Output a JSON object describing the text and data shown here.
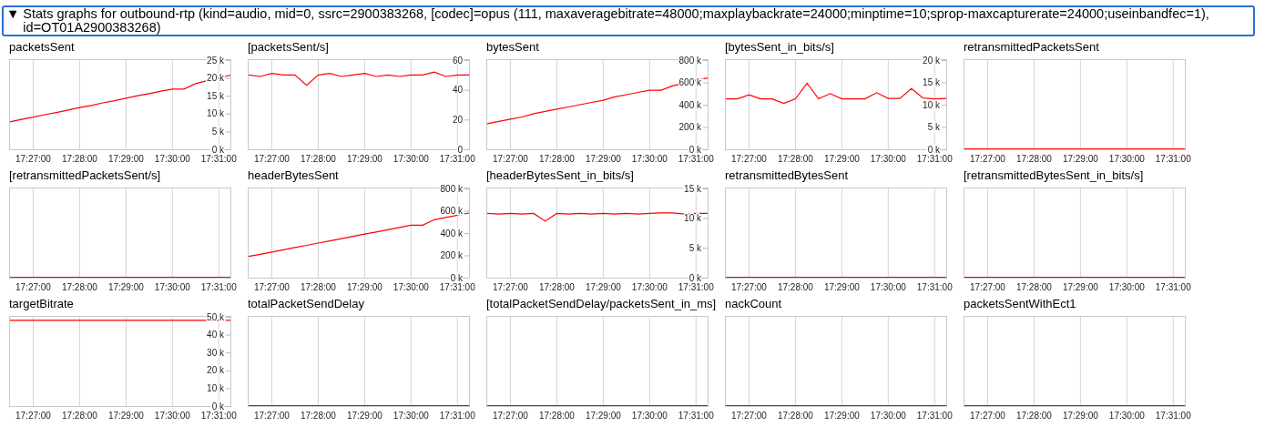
{
  "section": {
    "toggle": "▼",
    "title": "Stats graphs for outbound-rtp (kind=audio, mid=0, ssrc=2900383268, [codec]=opus (111, maxaveragebitrate=48000;maxplaybackrate=24000;minptime=10;sprop-maxcapturerate=24000;useinbandfec=1), id=OT01A2900383268)"
  },
  "charts": [
    {
      "kind": "plot",
      "chart_data": {
        "type": "line",
        "title": "packetsSent",
        "grid": true,
        "categories": [
          null,
          null,
          "17:27:00",
          null,
          null,
          null,
          "17:28:00",
          null,
          null,
          null,
          "17:29:00",
          null,
          null,
          null,
          "17:30:00",
          null,
          null,
          null,
          "17:31:00",
          null
        ],
        "values": [
          7700,
          8400,
          9000,
          9700,
          10300,
          11000,
          11700,
          12300,
          13000,
          13600,
          14300,
          15000,
          15600,
          16300,
          16900,
          16900,
          18400,
          19200,
          20000,
          20800
        ],
        "ylim": [
          0,
          25000
        ],
        "yticks": [
          {
            "value": 0,
            "label": "0 k"
          },
          {
            "value": 5000,
            "label": "5 k"
          },
          {
            "value": 10000,
            "label": "10 k"
          },
          {
            "value": 15000,
            "label": "15 k"
          },
          {
            "value": 20000,
            "label": "20 k"
          },
          {
            "value": 25000,
            "label": "25 k"
          }
        ]
      }
    },
    {
      "kind": "plot",
      "chart_data": {
        "type": "line",
        "title": "[packetsSent/s]",
        "grid": true,
        "categories": [
          null,
          null,
          "17:27:00",
          null,
          null,
          null,
          "17:28:00",
          null,
          null,
          null,
          "17:29:00",
          null,
          null,
          null,
          "17:30:00",
          null,
          null,
          null,
          "17:31:00",
          null
        ],
        "values": [
          50,
          49,
          51,
          50,
          50,
          43,
          50,
          51,
          49,
          50,
          51,
          49,
          50,
          49,
          50,
          50,
          52,
          49,
          50,
          50
        ],
        "ylim": [
          0,
          60
        ],
        "yticks": [
          0,
          20,
          40,
          60
        ]
      }
    },
    {
      "kind": "plot",
      "chart_data": {
        "type": "line",
        "title": "bytesSent",
        "grid": true,
        "categories": [
          null,
          null,
          "17:27:00",
          null,
          null,
          null,
          "17:28:00",
          null,
          null,
          null,
          "17:29:00",
          null,
          null,
          null,
          "17:30:00",
          null,
          null,
          null,
          "17:31:00",
          null
        ],
        "values": [
          230000,
          250000,
          270000,
          290000,
          320000,
          340000,
          360000,
          380000,
          400000,
          420000,
          440000,
          470000,
          490000,
          510000,
          530000,
          530000,
          570000,
          590000,
          620000,
          640000
        ],
        "ylim": [
          0,
          800000
        ],
        "yticks": [
          {
            "value": 0,
            "label": "0 k"
          },
          {
            "value": 200000,
            "label": "200 k"
          },
          {
            "value": 400000,
            "label": "400 k"
          },
          {
            "value": 600000,
            "label": "600 k"
          },
          {
            "value": 800000,
            "label": "800 k"
          }
        ]
      }
    },
    {
      "kind": "plot",
      "chart_data": {
        "type": "line",
        "title": "[bytesSent_in_bits/s]",
        "grid": true,
        "categories": [
          null,
          null,
          "17:27:00",
          null,
          null,
          null,
          "17:28:00",
          null,
          null,
          null,
          "17:29:00",
          null,
          null,
          null,
          "17:30:00",
          null,
          null,
          null,
          "17:31:00",
          null
        ],
        "values": [
          11300,
          11300,
          12200,
          11300,
          11300,
          10300,
          11300,
          14800,
          11300,
          12500,
          11300,
          11300,
          11300,
          12700,
          11400,
          11400,
          13600,
          11500,
          11300,
          11400
        ],
        "ylim": [
          0,
          20000
        ],
        "yticks": [
          {
            "value": 0,
            "label": "0 k"
          },
          {
            "value": 5000,
            "label": "5 k"
          },
          {
            "value": 10000,
            "label": "10 k"
          },
          {
            "value": 15000,
            "label": "15 k"
          },
          {
            "value": 20000,
            "label": "20 k"
          }
        ]
      }
    },
    {
      "kind": "flat",
      "title": "retransmittedPacketsSent",
      "grid": true,
      "x_labels": [
        "17:27:00",
        "17:28:00",
        "17:29:00",
        "17:30:00",
        "17:31:00"
      ]
    },
    {
      "kind": "flat",
      "title": "[retransmittedPacketsSent/s]",
      "grid": true,
      "x_labels": [
        "17:27:00",
        "17:28:00",
        "17:29:00",
        "17:30:00",
        "17:31:00"
      ]
    },
    {
      "kind": "plot",
      "chart_data": {
        "type": "line",
        "title": "headerBytesSent",
        "grid": true,
        "categories": [
          null,
          null,
          "17:27:00",
          null,
          null,
          null,
          "17:28:00",
          null,
          null,
          null,
          "17:29:00",
          null,
          null,
          null,
          "17:30:00",
          null,
          null,
          null,
          "17:31:00",
          null
        ],
        "values": [
          190000,
          210000,
          230000,
          250000,
          270000,
          290000,
          310000,
          330000,
          350000,
          370000,
          390000,
          410000,
          430000,
          450000,
          470000,
          470000,
          520000,
          540000,
          560000,
          580000
        ],
        "ylim": [
          0,
          800000
        ],
        "yticks": [
          {
            "value": 0,
            "label": "0 k"
          },
          {
            "value": 200000,
            "label": "200 k"
          },
          {
            "value": 400000,
            "label": "400 k"
          },
          {
            "value": 600000,
            "label": "600 k"
          },
          {
            "value": 800000,
            "label": "800 k"
          }
        ]
      }
    },
    {
      "kind": "plot",
      "chart_data": {
        "type": "line",
        "title": "[headerBytesSent_in_bits/s]",
        "grid": true,
        "categories": [
          null,
          null,
          "17:27:00",
          null,
          null,
          null,
          "17:28:00",
          null,
          null,
          null,
          "17:29:00",
          null,
          null,
          null,
          "17:30:00",
          null,
          null,
          null,
          "17:31:00",
          null
        ],
        "values": [
          10800,
          10700,
          10800,
          10700,
          10800,
          9500,
          10800,
          10700,
          10800,
          10700,
          10800,
          10700,
          10800,
          10700,
          10800,
          10900,
          10900,
          10700,
          10800,
          10800
        ],
        "ylim": [
          0,
          15000
        ],
        "yticks": [
          {
            "value": 0,
            "label": "0 k"
          },
          {
            "value": 5000,
            "label": "5 k"
          },
          {
            "value": 10000,
            "label": "10 k"
          },
          {
            "value": 15000,
            "label": "15 k"
          }
        ]
      }
    },
    {
      "kind": "flat",
      "title": "retransmittedBytesSent",
      "grid": true,
      "x_labels": [
        "17:27:00",
        "17:28:00",
        "17:29:00",
        "17:30:00",
        "17:31:00"
      ]
    },
    {
      "kind": "flat",
      "title": "[retransmittedBytesSent_in_bits/s]",
      "grid": true,
      "x_labels": [
        "17:27:00",
        "17:28:00",
        "17:29:00",
        "17:30:00",
        "17:31:00"
      ]
    },
    {
      "kind": "plot",
      "chart_data": {
        "type": "line",
        "title": "targetBitrate",
        "grid": true,
        "categories": [
          null,
          null,
          "17:27:00",
          null,
          null,
          null,
          "17:28:00",
          null,
          null,
          null,
          "17:29:00",
          null,
          null,
          null,
          "17:30:00",
          null,
          null,
          null,
          "17:31:00",
          null
        ],
        "values": [
          48000,
          48000,
          48000,
          48000,
          48000,
          48000,
          48000,
          48000,
          48000,
          48000,
          48000,
          48000,
          48000,
          48000,
          48000,
          48000,
          48000,
          48000,
          48000,
          48000
        ],
        "ylim": [
          0,
          50000
        ],
        "yticks": [
          {
            "value": 0,
            "label": "0 k"
          },
          {
            "value": 10000,
            "label": "10 k"
          },
          {
            "value": 20000,
            "label": "20 k"
          },
          {
            "value": 30000,
            "label": "30 k"
          },
          {
            "value": 40000,
            "label": "40 k"
          },
          {
            "value": 50000,
            "label": "50 k"
          }
        ]
      }
    },
    {
      "kind": "flat",
      "title": "totalPacketSendDelay",
      "grid": true,
      "x_labels": [
        "17:27:00",
        "17:28:00",
        "17:29:00",
        "17:30:00",
        "17:31:00"
      ]
    },
    {
      "kind": "flat",
      "title": "[totalPacketSendDelay/packetsSent_in_ms]",
      "grid": true,
      "x_labels": [
        "17:27:00",
        "17:28:00",
        "17:29:00",
        "17:30:00",
        "17:31:00"
      ]
    },
    {
      "kind": "flat",
      "title": "nackCount",
      "grid": true,
      "x_labels": [
        "17:27:00",
        "17:28:00",
        "17:29:00",
        "17:30:00",
        "17:31:00"
      ]
    },
    {
      "kind": "flat",
      "title": "packetsSentWithEct1",
      "grid": true,
      "x_labels": [
        "17:27:00",
        "17:28:00",
        "17:29:00",
        "17:30:00",
        "17:31:00"
      ]
    }
  ]
}
